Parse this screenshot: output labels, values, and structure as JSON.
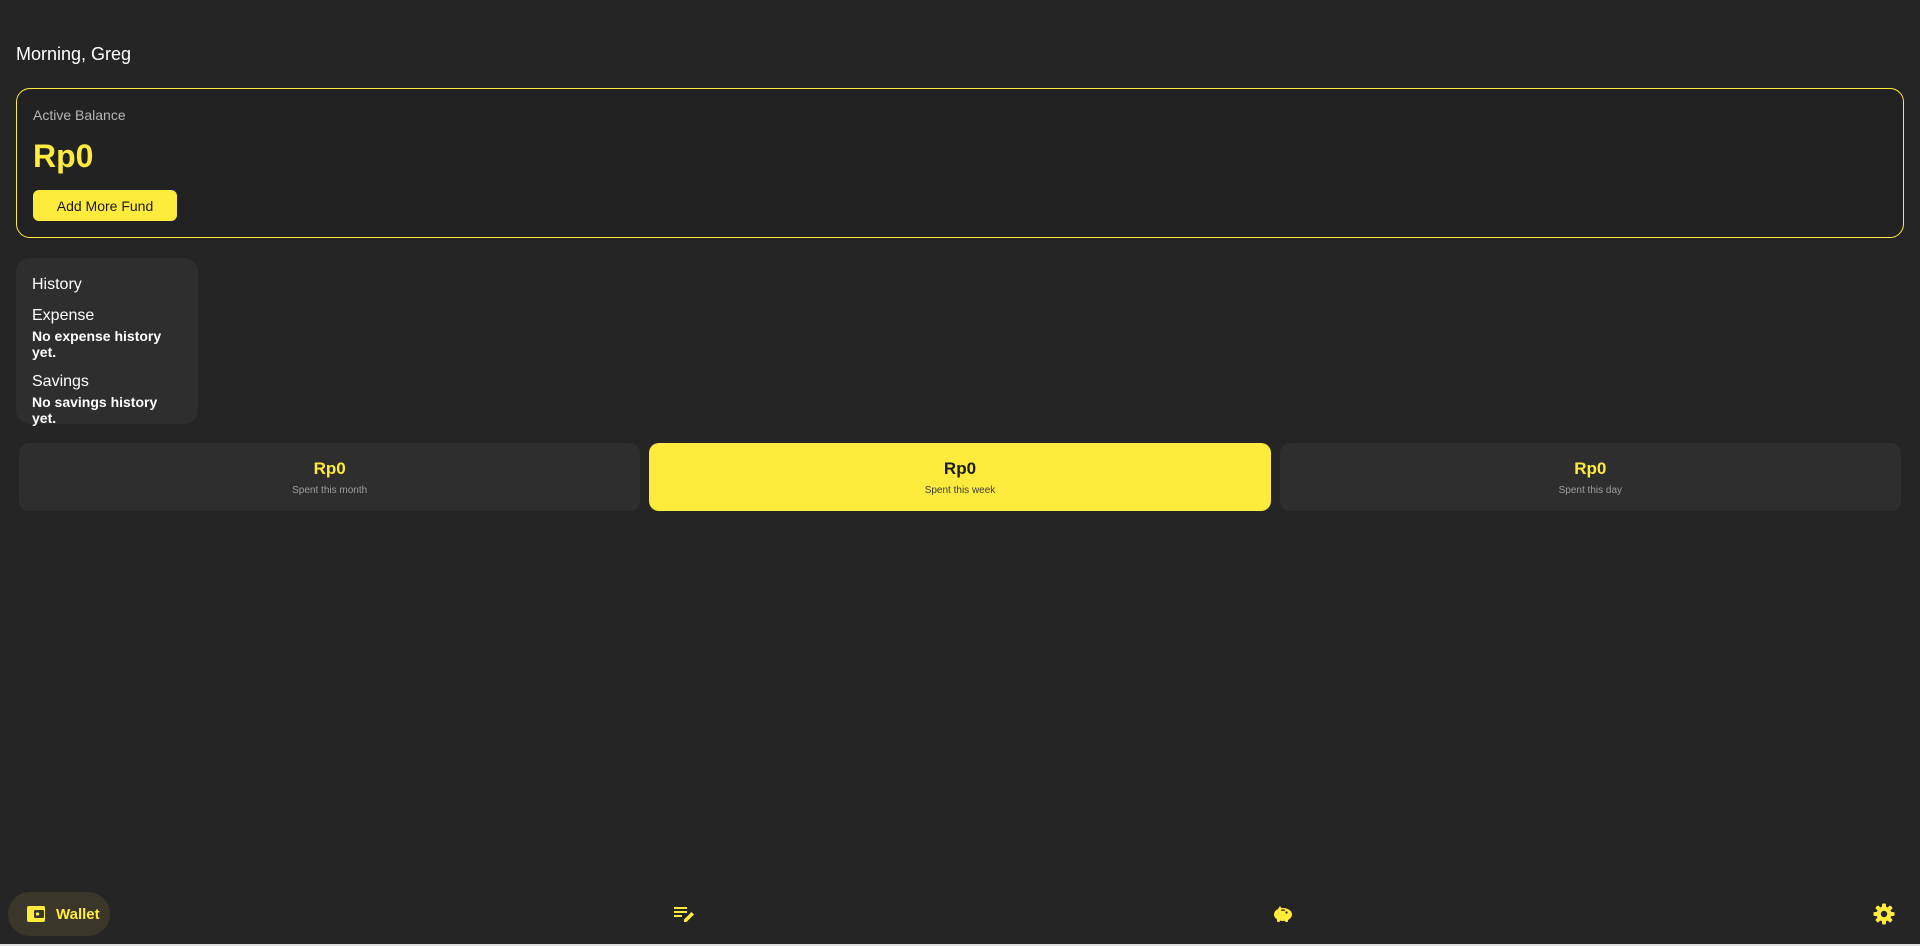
{
  "greeting": "Morning, Greg",
  "balance": {
    "label": "Active Balance",
    "amount": "Rp0",
    "add_fund_label": "Add More Fund"
  },
  "history": {
    "title": "History",
    "expense": {
      "title": "Expense",
      "empty": "No expense history yet."
    },
    "savings": {
      "title": "Savings",
      "empty": "No savings history yet."
    }
  },
  "stats": [
    {
      "amount": "Rp0",
      "label": "Spent this month",
      "active": false
    },
    {
      "amount": "Rp0",
      "label": "Spent this week",
      "active": true
    },
    {
      "amount": "Rp0",
      "label": "Spent this day",
      "active": false
    }
  ],
  "nav": {
    "wallet_label": "Wallet",
    "icons": [
      "wallet-icon",
      "edit-list-icon",
      "piggy-bank-icon",
      "gear-icon"
    ]
  },
  "colors": {
    "accent": "#ffeb3b",
    "background": "#252525",
    "card": "#2e2e2e"
  }
}
